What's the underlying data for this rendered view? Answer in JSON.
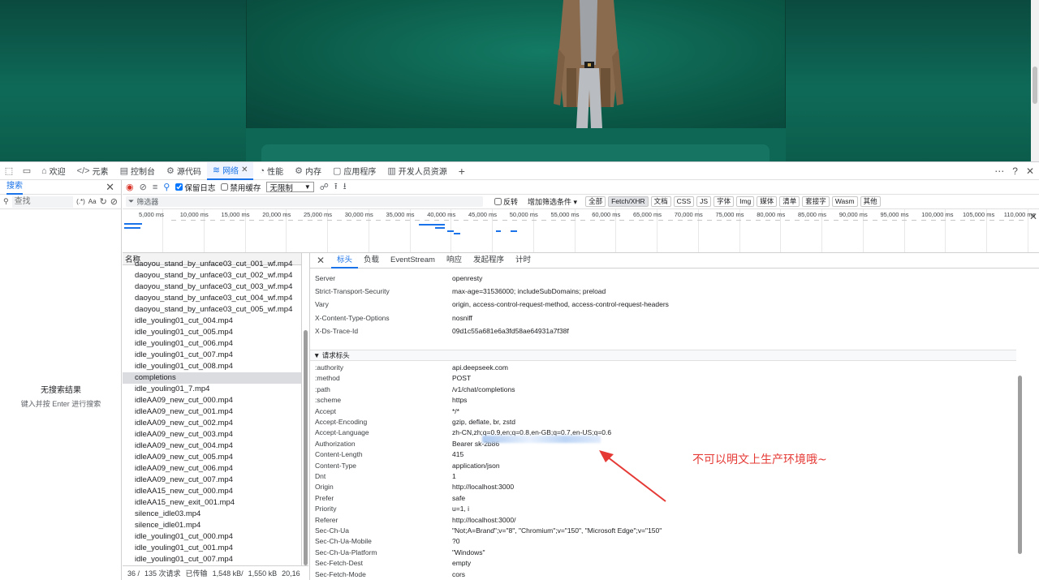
{
  "devtools_tabs": [
    {
      "label": "欢迎",
      "icon": "home-icon"
    },
    {
      "label": "元素",
      "icon": "code-icon"
    },
    {
      "label": "控制台",
      "icon": "console-icon"
    },
    {
      "label": "源代码",
      "icon": "bug-icon"
    },
    {
      "label": "网络",
      "icon": "wifi-icon",
      "active": true
    },
    {
      "label": "性能",
      "icon": "gauge-icon"
    },
    {
      "label": "内存",
      "icon": "chip-icon"
    },
    {
      "label": "应用程序",
      "icon": "window-icon"
    },
    {
      "label": "开发人员资源",
      "icon": "resource-icon"
    }
  ],
  "search": {
    "title": "搜索",
    "placeholder": "查找",
    "regex_label": "(.*)",
    "case_label": "Aa",
    "no_result_title": "无搜索结果",
    "no_result_hint": "键入并按 Enter 进行搜索"
  },
  "toolbar": {
    "preserve_log": "保留日志",
    "disable_cache": "禁用缓存",
    "throttle": "无限制"
  },
  "filter": {
    "placeholder": "筛选器",
    "invert": "反转",
    "more_filters": "增加筛选条件",
    "types": [
      "全部",
      "Fetch/XHR",
      "文档",
      "CSS",
      "JS",
      "字体",
      "Img",
      "媒体",
      "清单",
      "套接字",
      "Wasm",
      "其他"
    ],
    "active_type": "Fetch/XHR"
  },
  "timeline": {
    "ticks": [
      "5,000 ms",
      "10,000 ms",
      "15,000 ms",
      "20,000 ms",
      "25,000 ms",
      "30,000 ms",
      "35,000 ms",
      "40,000 ms",
      "45,000 ms",
      "50,000 ms",
      "55,000 ms",
      "60,000 ms",
      "65,000 ms",
      "70,000 ms",
      "75,000 ms",
      "80,000 ms",
      "85,000 ms",
      "90,000 ms",
      "95,000 ms",
      "100,000 ms",
      "105,000 ms",
      "110,000 ms"
    ]
  },
  "request_list": {
    "header": "名称",
    "rows": [
      "daoyou_stand_by_unface03_cut_001_wf.mp4",
      "daoyou_stand_by_unface03_cut_002_wf.mp4",
      "daoyou_stand_by_unface03_cut_003_wf.mp4",
      "daoyou_stand_by_unface03_cut_004_wf.mp4",
      "daoyou_stand_by_unface03_cut_005_wf.mp4",
      "idle_youling01_cut_004.mp4",
      "idle_youling01_cut_005.mp4",
      "idle_youling01_cut_006.mp4",
      "idle_youling01_cut_007.mp4",
      "idle_youling01_cut_008.mp4",
      "completions",
      "idle_youling01_7.mp4",
      "idleAA09_new_cut_000.mp4",
      "idleAA09_new_cut_001.mp4",
      "idleAA09_new_cut_002.mp4",
      "idleAA09_new_cut_003.mp4",
      "idleAA09_new_cut_004.mp4",
      "idleAA09_new_cut_005.mp4",
      "idleAA09_new_cut_006.mp4",
      "idleAA09_new_cut_007.mp4",
      "idleAA15_new_cut_000.mp4",
      "idleAA15_new_exit_001.mp4",
      "silence_idle03.mp4",
      "silence_idle01.mp4",
      "idle_youling01_cut_000.mp4",
      "idle_youling01_cut_001.mp4",
      "idle_youling01_cut_007.mp4"
    ],
    "selected": "completions"
  },
  "status": {
    "requests": "36 /",
    "total": "135 次请求",
    "transferred_label": "已传输",
    "transferred": "1,548 kB/",
    "resources": "1,550 kB",
    "extra": "20,16"
  },
  "detail_tabs": [
    "标头",
    "负载",
    "EventStream",
    "响应",
    "发起程序",
    "计时"
  ],
  "response_headers": [
    {
      "k": "Server",
      "v": "openresty"
    },
    {
      "k": "Strict-Transport-Security",
      "v": "max-age=31536000; includeSubDomains; preload"
    },
    {
      "k": "Vary",
      "v": "origin, access-control-request-method, access-control-request-headers"
    },
    {
      "k": "X-Content-Type-Options",
      "v": "nosniff"
    },
    {
      "k": "X-Ds-Trace-Id",
      "v": "09d1c55a681e6a3fd58ae64931a7f38f"
    }
  ],
  "request_section_title": "▼ 请求标头",
  "request_headers": [
    {
      "k": ":authority",
      "v": "api.deepseek.com"
    },
    {
      "k": ":method",
      "v": "POST"
    },
    {
      "k": ":path",
      "v": "/v1/chat/completions"
    },
    {
      "k": ":scheme",
      "v": "https"
    },
    {
      "k": "Accept",
      "v": "*/*"
    },
    {
      "k": "Accept-Encoding",
      "v": "gzip, deflate, br, zstd"
    },
    {
      "k": "Accept-Language",
      "v": "zh-CN,zh;q=0.9,en;q=0.8,en-GB;q=0.7,en-US;q=0.6"
    },
    {
      "k": "Authorization",
      "v": "Bearer sk-2b86"
    },
    {
      "k": "Content-Length",
      "v": "415"
    },
    {
      "k": "Content-Type",
      "v": "application/json"
    },
    {
      "k": "Dnt",
      "v": "1"
    },
    {
      "k": "Origin",
      "v": "http://localhost:3000"
    },
    {
      "k": "Prefer",
      "v": "safe"
    },
    {
      "k": "Priority",
      "v": "u=1, i"
    },
    {
      "k": "Referer",
      "v": "http://localhost:3000/"
    },
    {
      "k": "Sec-Ch-Ua",
      "v": "\"Not;A=Brand\";v=\"8\", \"Chromium\";v=\"150\", \"Microsoft Edge\";v=\"150\""
    },
    {
      "k": "Sec-Ch-Ua-Mobile",
      "v": "?0"
    },
    {
      "k": "Sec-Ch-Ua-Platform",
      "v": "\"Windows\""
    },
    {
      "k": "Sec-Fetch-Dest",
      "v": "empty"
    },
    {
      "k": "Sec-Fetch-Mode",
      "v": "cors"
    }
  ],
  "annotation": "不可以明文上生产环境哦~",
  "colors": {
    "accent": "#1a73e8",
    "annotation": "#e53935",
    "page_bg": "#0e6a57"
  }
}
